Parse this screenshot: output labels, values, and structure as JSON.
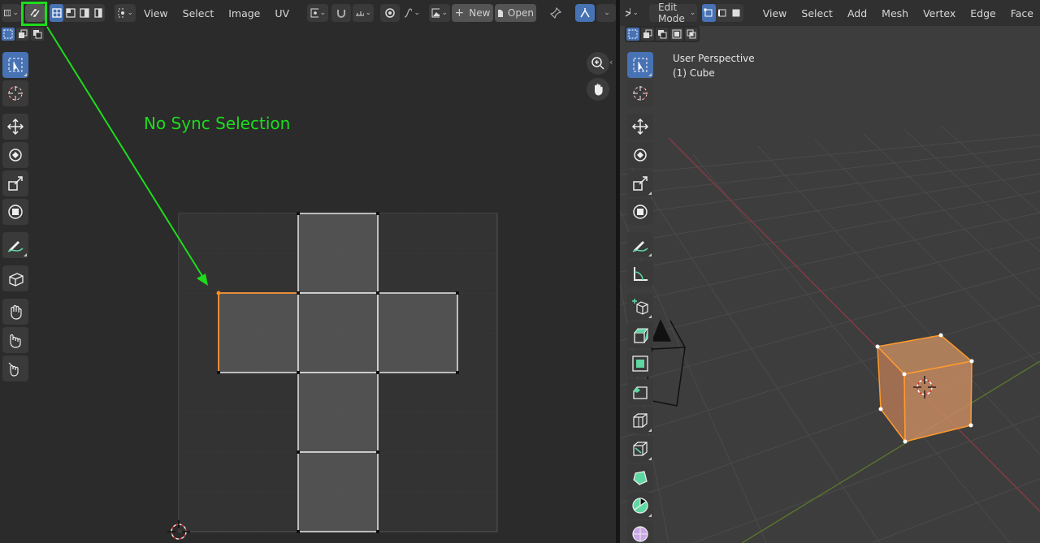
{
  "uv_editor": {
    "header": {
      "menus": [
        "View",
        "Select",
        "Image",
        "UV"
      ],
      "new_label": "New",
      "open_label": "Open"
    },
    "annotation": {
      "text": "No Sync Selection",
      "color": "#1ddc1d"
    }
  },
  "viewport": {
    "header": {
      "mode_label": "Edit Mode",
      "menus": [
        "View",
        "Select",
        "Add",
        "Mesh",
        "Vertex",
        "Edge",
        "Face"
      ]
    },
    "overlay": {
      "perspective": "User Perspective",
      "object": "(1) Cube"
    }
  },
  "colors": {
    "accent": "#4772b3",
    "selection": "#ff8c1a",
    "annotation": "#1ddc1d"
  }
}
